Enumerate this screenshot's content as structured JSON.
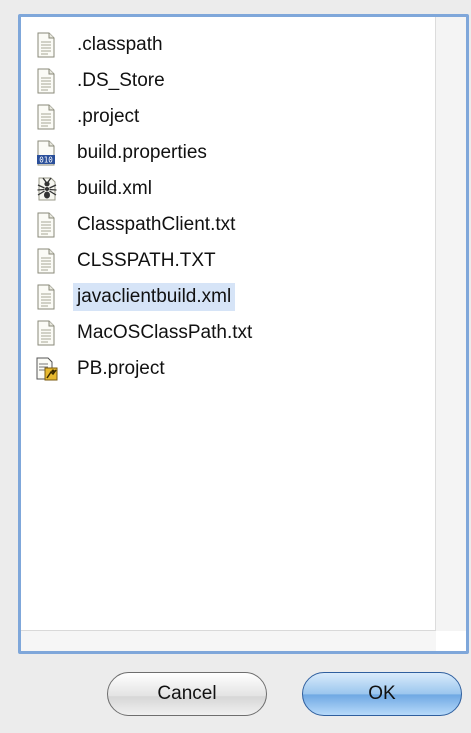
{
  "file_list": {
    "items": [
      {
        "name": ".classpath",
        "icon": "text-file-icon"
      },
      {
        "name": ".DS_Store",
        "icon": "text-file-icon"
      },
      {
        "name": ".project",
        "icon": "text-file-icon"
      },
      {
        "name": "build.properties",
        "icon": "binary-file-icon"
      },
      {
        "name": "build.xml",
        "icon": "ant-build-file-icon"
      },
      {
        "name": "ClasspathClient.txt",
        "icon": "text-file-icon"
      },
      {
        "name": "CLSSPATH.TXT",
        "icon": "text-file-icon"
      },
      {
        "name": "javaclientbuild.xml",
        "icon": "text-file-icon",
        "selected": true
      },
      {
        "name": "MacOSClassPath.txt",
        "icon": "text-file-icon"
      },
      {
        "name": "PB.project",
        "icon": "project-builder-file-icon"
      }
    ],
    "selection_color": "#d6e4f7"
  },
  "buttons": {
    "cancel_label": "Cancel",
    "ok_label": "OK"
  },
  "colors": {
    "focus_ring": "#7fa7da",
    "default_button": "#6fa8e3"
  }
}
